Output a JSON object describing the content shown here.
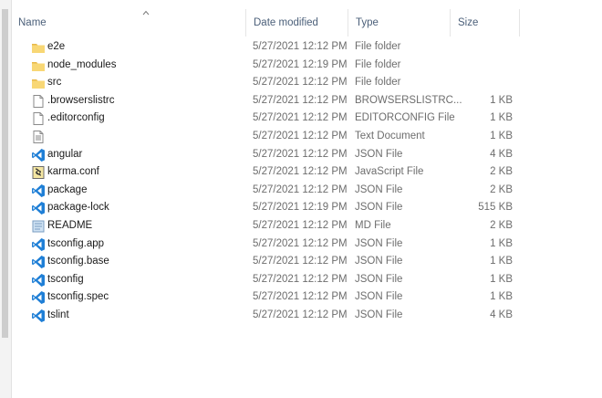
{
  "columns": {
    "name": "Name",
    "date_modified": "Date modified",
    "type": "Type",
    "size": "Size"
  },
  "files": [
    {
      "name": "e2e",
      "date": "5/27/2021 12:12 PM",
      "type": "File folder",
      "size": "",
      "icon": "folder-icon"
    },
    {
      "name": "node_modules",
      "date": "5/27/2021 12:19 PM",
      "type": "File folder",
      "size": "",
      "icon": "folder-icon"
    },
    {
      "name": "src",
      "date": "5/27/2021 12:12 PM",
      "type": "File folder",
      "size": "",
      "icon": "folder-icon"
    },
    {
      "name": ".browserslistrc",
      "date": "5/27/2021 12:12 PM",
      "type": "BROWSERSLISTRC...",
      "size": "1 KB",
      "icon": "blank-file-icon"
    },
    {
      "name": ".editorconfig",
      "date": "5/27/2021 12:12 PM",
      "type": "EDITORCONFIG File",
      "size": "1 KB",
      "icon": "blank-file-icon"
    },
    {
      "name": "",
      "date": "5/27/2021 12:12 PM",
      "type": "Text Document",
      "size": "1 KB",
      "icon": "text-file-icon"
    },
    {
      "name": "angular",
      "date": "5/27/2021 12:12 PM",
      "type": "JSON File",
      "size": "4 KB",
      "icon": "vscode-icon"
    },
    {
      "name": "karma.conf",
      "date": "5/27/2021 12:12 PM",
      "type": "JavaScript File",
      "size": "2 KB",
      "icon": "javascript-file-icon"
    },
    {
      "name": "package",
      "date": "5/27/2021 12:12 PM",
      "type": "JSON File",
      "size": "2 KB",
      "icon": "vscode-icon"
    },
    {
      "name": "package-lock",
      "date": "5/27/2021 12:19 PM",
      "type": "JSON File",
      "size": "515 KB",
      "icon": "vscode-icon"
    },
    {
      "name": "README",
      "date": "5/27/2021 12:12 PM",
      "type": "MD File",
      "size": "2 KB",
      "icon": "md-file-icon"
    },
    {
      "name": "tsconfig.app",
      "date": "5/27/2021 12:12 PM",
      "type": "JSON File",
      "size": "1 KB",
      "icon": "vscode-icon"
    },
    {
      "name": "tsconfig.base",
      "date": "5/27/2021 12:12 PM",
      "type": "JSON File",
      "size": "1 KB",
      "icon": "vscode-icon"
    },
    {
      "name": "tsconfig",
      "date": "5/27/2021 12:12 PM",
      "type": "JSON File",
      "size": "1 KB",
      "icon": "vscode-icon"
    },
    {
      "name": "tsconfig.spec",
      "date": "5/27/2021 12:12 PM",
      "type": "JSON File",
      "size": "1 KB",
      "icon": "vscode-icon"
    },
    {
      "name": "tslint",
      "date": "5/27/2021 12:12 PM",
      "type": "JSON File",
      "size": "4 KB",
      "icon": "vscode-icon"
    }
  ],
  "colors": {
    "header_text": "#4c607a",
    "folder": "#f8d775",
    "vscode": "#1f7fd6"
  }
}
